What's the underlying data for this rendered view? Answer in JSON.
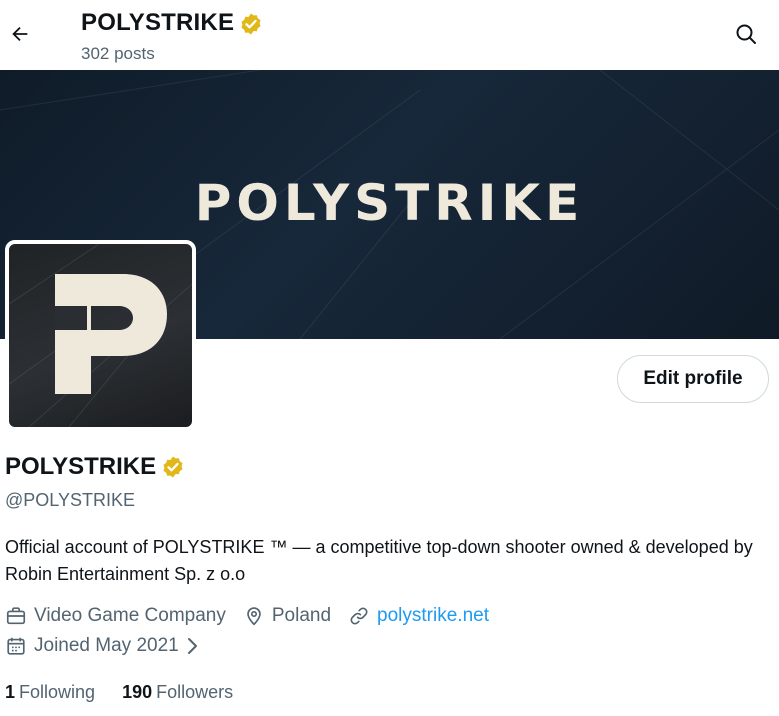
{
  "header": {
    "title": "POLYSTRIKE",
    "posts_count": "302 posts"
  },
  "banner": {
    "text": "POLYSTRIKE"
  },
  "profile": {
    "display_name": "POLYSTRIKE",
    "handle": "@POLYSTRIKE",
    "verified": true,
    "bio": "Official account of POLYSTRIKE ™ — a competitive top-down shooter owned & developed by Robin Entertainment Sp. z o.o",
    "category": "Video Game Company",
    "location": "Poland",
    "website": "polystrike.net",
    "joined": "Joined May 2021",
    "following_count": "1",
    "following_label": "Following",
    "followers_count": "190",
    "followers_label": "Followers"
  },
  "actions": {
    "edit_profile": "Edit profile"
  },
  "icons": {
    "back": "arrow-left-icon",
    "search": "search-icon",
    "verified": "verified-badge-icon",
    "category": "briefcase-icon",
    "location": "location-pin-icon",
    "website": "link-icon",
    "joined": "calendar-icon",
    "chevron": "chevron-right-icon"
  },
  "colors": {
    "accent": "#1d9bf0",
    "verified_gold": "#e2b719",
    "secondary_text": "#536471",
    "banner_bg": "#13202e",
    "logo_cream": "#efe9dc"
  }
}
